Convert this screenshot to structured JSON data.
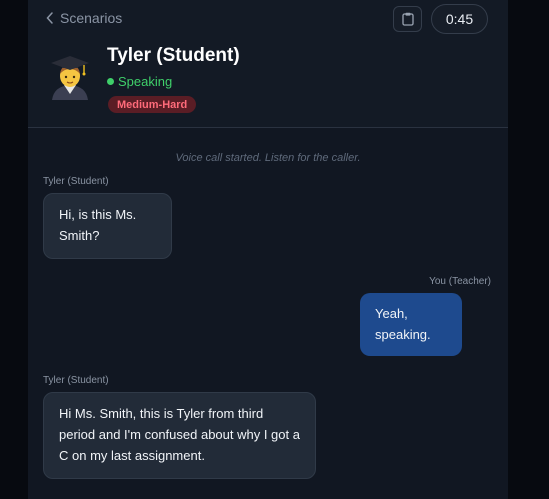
{
  "header": {
    "back_label": "Scenarios",
    "timer": "0:45",
    "contact_name": "Tyler (Student)",
    "status": "Speaking",
    "difficulty": "Medium-Hard",
    "avatar_icon": "student-emoji-icon",
    "clipboard_icon": "clipboard-icon"
  },
  "chat": {
    "system_message": "Voice call started. Listen for the caller.",
    "messages": [
      {
        "sender": "Tyler (Student)",
        "role": "caller",
        "text": "Hi, is this Ms. Smith?"
      },
      {
        "sender": "You (Teacher)",
        "role": "user",
        "text": "Yeah, speaking."
      },
      {
        "sender": "Tyler (Student)",
        "role": "caller",
        "text": "Hi Ms. Smith, this is Tyler from third period and I'm confused about why I got a C on my last assignment."
      }
    ]
  },
  "colors": {
    "status_green": "#3fcf6a",
    "badge_red": "#ff6b7a",
    "user_bubble": "#1e4a8e",
    "caller_bubble": "#222b38"
  }
}
